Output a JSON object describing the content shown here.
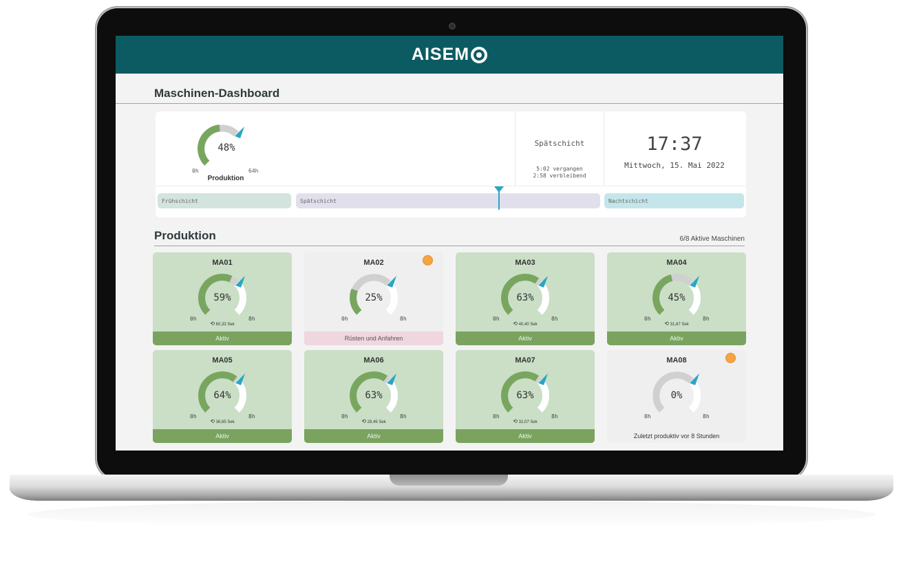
{
  "app": {
    "logo_text": "AISEM",
    "brand_color": "#0d5b62",
    "page_title": "Maschinen-Dashboard"
  },
  "overview": {
    "production_percent": 48,
    "production_value": "48%",
    "min_label": "0h",
    "max_label": "64h",
    "caption": "Produktion",
    "shift_name": "Spätschicht",
    "elapsed": "5:02 vergangen",
    "remaining": "2:58 verbleibend",
    "time": "17:37",
    "date": "Mittwoch, 15. Mai 2022",
    "shift_bars": [
      "Frühschicht",
      "Spätschicht",
      "Nachtschicht"
    ]
  },
  "production": {
    "title": "Produktion",
    "active_count": "6/8 Aktive Maschinen",
    "machines": [
      {
        "name": "MA01",
        "percent": 59,
        "value": "59%",
        "min": "0h",
        "max": "8h",
        "cycle": "60,33 Sek",
        "status": "Aktiv",
        "state": "active",
        "alert": false
      },
      {
        "name": "MA02",
        "percent": 25,
        "value": "25%",
        "min": "0h",
        "max": "8h",
        "cycle": "",
        "status": "Rüsten und Anfahren",
        "state": "setup",
        "alert": true
      },
      {
        "name": "MA03",
        "percent": 63,
        "value": "63%",
        "min": "0h",
        "max": "8h",
        "cycle": "40,40 Sek",
        "status": "Aktiv",
        "state": "active",
        "alert": false
      },
      {
        "name": "MA04",
        "percent": 45,
        "value": "45%",
        "min": "0h",
        "max": "8h",
        "cycle": "31,67 Sek",
        "status": "Aktiv",
        "state": "active",
        "alert": false
      },
      {
        "name": "MA05",
        "percent": 64,
        "value": "64%",
        "min": "0h",
        "max": "8h",
        "cycle": "36,65 Sek",
        "status": "Aktiv",
        "state": "active",
        "alert": false
      },
      {
        "name": "MA06",
        "percent": 63,
        "value": "63%",
        "min": "0h",
        "max": "8h",
        "cycle": "28,45 Sek",
        "status": "Aktiv",
        "state": "active",
        "alert": false
      },
      {
        "name": "MA07",
        "percent": 63,
        "value": "63%",
        "min": "0h",
        "max": "8h",
        "cycle": "32,07 Sek",
        "status": "Aktiv",
        "state": "active",
        "alert": false
      },
      {
        "name": "MA08",
        "percent": 0,
        "value": "0%",
        "min": "0h",
        "max": "8h",
        "cycle": "",
        "status": "Zuletzt produktiv vor 8 Stunden",
        "state": "idle",
        "alert": true
      }
    ]
  },
  "colors": {
    "gauge_green": "#78a65f",
    "gauge_grey": "#d0d0d0",
    "marker_cyan": "#2aa6c4",
    "alert_orange": "#f5a443"
  },
  "icons": {
    "cycle": "timer-icon",
    "marker": "triangle-marker-icon"
  }
}
